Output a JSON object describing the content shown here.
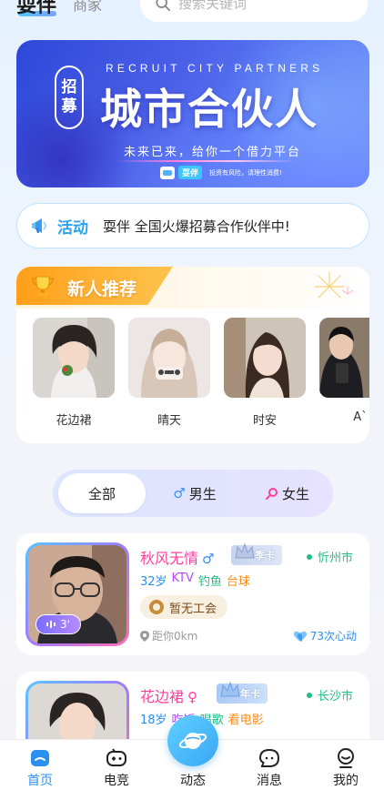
{
  "header": {
    "app_name": "耍伴",
    "tab_merchant": "商家",
    "search_placeholder": "搜索关键词"
  },
  "banner": {
    "badge": [
      "招",
      "募"
    ],
    "english": "RECRUIT CITY PARTNERS",
    "title": "城市合伙人",
    "subtitle": "未来已来，给你一个借力平台",
    "logo_text": "耍伴",
    "disclaimer": "投资有风险，请理性消费!"
  },
  "activity": {
    "label": "活动",
    "text": "耍伴 全国火爆招募合作伙伴中!"
  },
  "new_recommend": {
    "title": "新人推荐",
    "items": [
      {
        "name": "花边裙"
      },
      {
        "name": "晴天"
      },
      {
        "name": "时安"
      },
      {
        "name": "A`"
      }
    ]
  },
  "filter": {
    "all": "全部",
    "male": "男生",
    "female": "女生"
  },
  "users": [
    {
      "name": "秋风无情",
      "gender": "♂",
      "vip": "季卡",
      "city": "忻州市",
      "voice": "3'",
      "age": "32岁",
      "tags": [
        "KTV",
        "钓鱼",
        "台球"
      ],
      "guild": "暂无工会",
      "distance": "距你0km",
      "hearts": "73次心动"
    },
    {
      "name": "花边裙",
      "gender": "♀",
      "vip": "年卡",
      "city": "长沙市",
      "age": "18岁",
      "tags": [
        "吃饭",
        "唱歌",
        "看电影"
      ]
    }
  ],
  "nav": {
    "home": "首页",
    "esports": "电竞",
    "moments": "动态",
    "messages": "消息",
    "mine": "我的"
  },
  "colors": {
    "accent": "#2b8ff0",
    "pink": "#ff3f9f",
    "green": "#1fbe86",
    "orange": "#ff9f1a"
  }
}
